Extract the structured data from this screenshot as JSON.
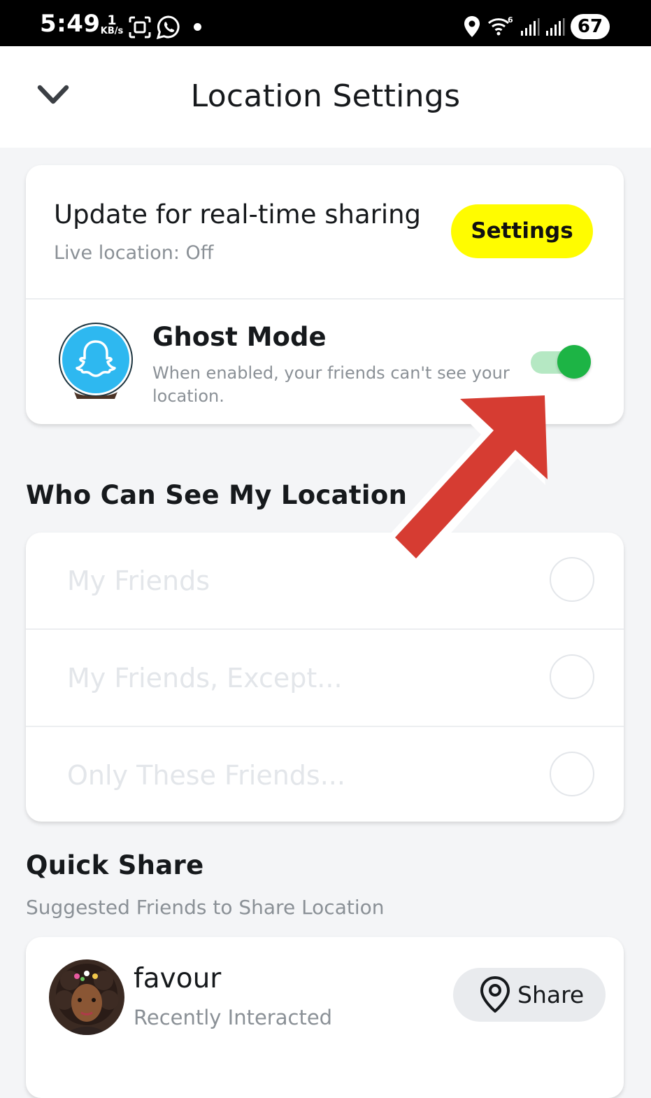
{
  "status_bar": {
    "time": "5:49",
    "net_speed_value": "1",
    "net_speed_unit": "KB/s",
    "battery": "67",
    "icons": [
      "screenshot-icon",
      "whatsapp-icon",
      "dot-icon",
      "location-icon",
      "wifi-icon",
      "signal-icon",
      "signal-icon",
      "battery-icon"
    ]
  },
  "header": {
    "title": "Location Settings",
    "back_icon": "chevron-down-icon"
  },
  "live_location": {
    "title": "Update for real-time sharing",
    "subtitle": "Live location: Off",
    "button_label": "Settings",
    "button_color": "#FFFC00"
  },
  "ghost_mode": {
    "title": "Ghost Mode",
    "description": "When enabled, your friends can't see your location.",
    "enabled": true,
    "toggle_color": "#1DB445"
  },
  "who_can_see": {
    "title": "Who Can See My Location",
    "options": [
      {
        "label": "My Friends",
        "selected": false
      },
      {
        "label": "My Friends, Except...",
        "selected": false
      },
      {
        "label": "Only These Friends...",
        "selected": false
      }
    ]
  },
  "quick_share": {
    "title": "Quick Share",
    "subtitle": "Suggested Friends to Share Location",
    "friends": [
      {
        "name": "favour",
        "subtitle": "Recently Interacted",
        "button_label": "Share",
        "button_icon": "location-pin-icon"
      }
    ]
  },
  "annotation": {
    "arrow_color": "#D63C32",
    "arrow_icon": "red-arrow-icon"
  }
}
